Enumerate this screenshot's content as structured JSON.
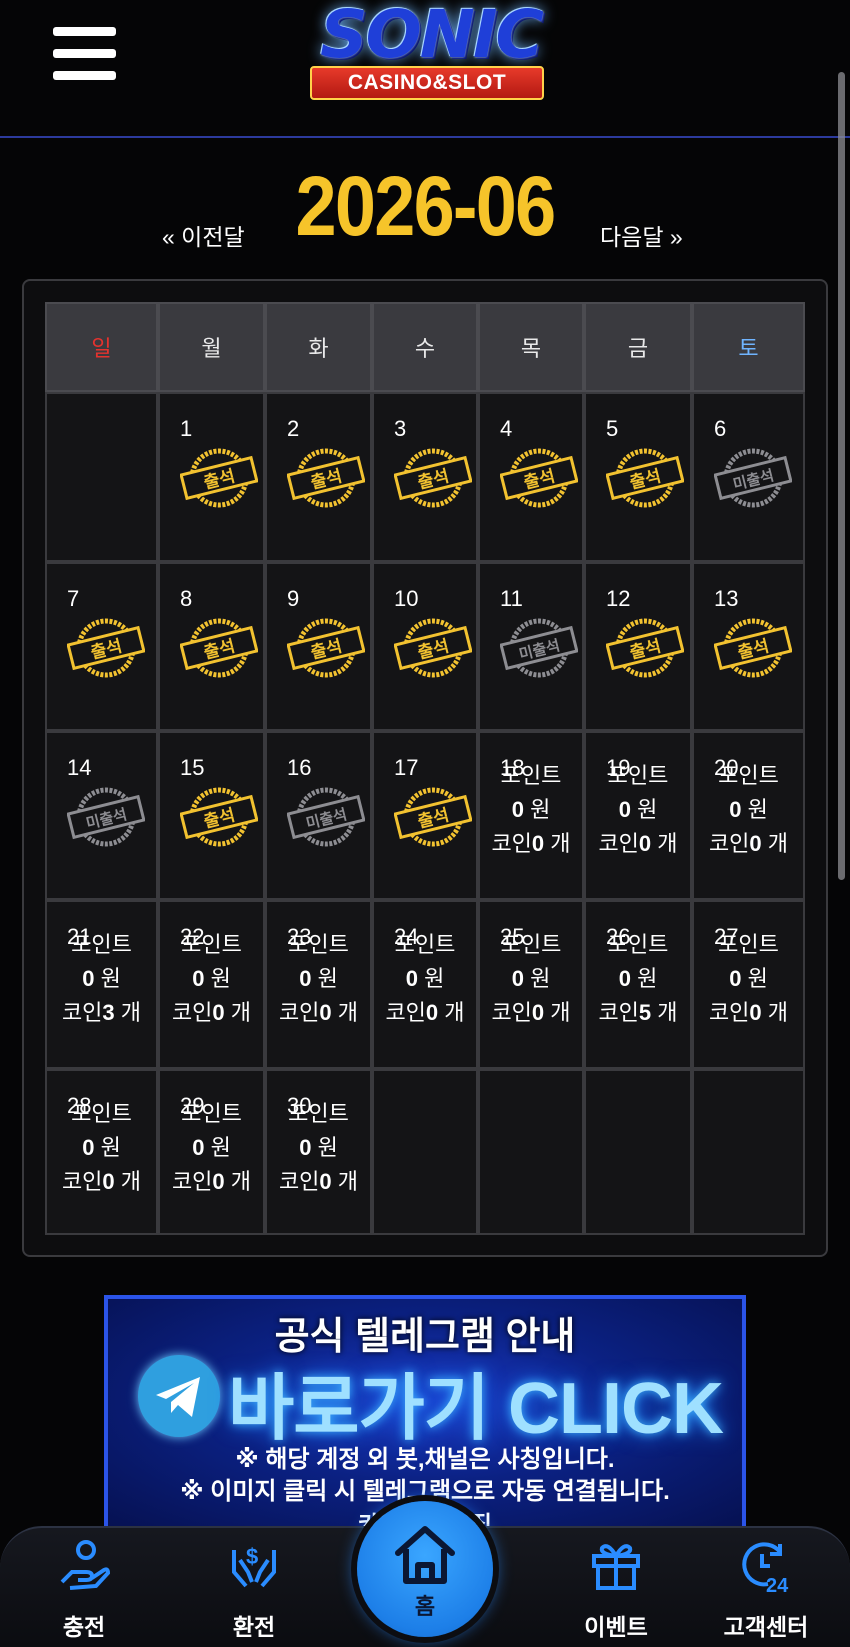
{
  "header": {
    "logo_main": "SONIC",
    "logo_sub": "CASINO&SLOT"
  },
  "month_nav": {
    "prev_label": "« 이전달",
    "title": "2026-06",
    "next_label": "다음달 »"
  },
  "calendar": {
    "weekdays": [
      "일",
      "월",
      "화",
      "수",
      "목",
      "금",
      "토"
    ],
    "stamp_attended": "출석",
    "stamp_absent": "미출석",
    "point_label": "포인트",
    "won_unit": "원",
    "coin_label": "코인",
    "coin_unit": "개",
    "days": [
      {
        "day": 1,
        "status": "attended"
      },
      {
        "day": 2,
        "status": "attended"
      },
      {
        "day": 3,
        "status": "attended"
      },
      {
        "day": 4,
        "status": "attended"
      },
      {
        "day": 5,
        "status": "attended"
      },
      {
        "day": 6,
        "status": "absent"
      },
      {
        "day": 7,
        "status": "attended"
      },
      {
        "day": 8,
        "status": "attended"
      },
      {
        "day": 9,
        "status": "attended"
      },
      {
        "day": 10,
        "status": "attended"
      },
      {
        "day": 11,
        "status": "absent"
      },
      {
        "day": 12,
        "status": "attended"
      },
      {
        "day": 13,
        "status": "attended"
      },
      {
        "day": 14,
        "status": "absent"
      },
      {
        "day": 15,
        "status": "attended"
      },
      {
        "day": 16,
        "status": "absent"
      },
      {
        "day": 17,
        "status": "attended"
      },
      {
        "day": 18,
        "status": "future",
        "points": 0,
        "coins": 0
      },
      {
        "day": 19,
        "status": "future",
        "points": 0,
        "coins": 0
      },
      {
        "day": 20,
        "status": "future",
        "points": 0,
        "coins": 0
      },
      {
        "day": 21,
        "status": "future",
        "points": 0,
        "coins": 3
      },
      {
        "day": 22,
        "status": "future",
        "points": 0,
        "coins": 0
      },
      {
        "day": 23,
        "status": "future",
        "points": 0,
        "coins": 0
      },
      {
        "day": 24,
        "status": "future",
        "points": 0,
        "coins": 0
      },
      {
        "day": 25,
        "status": "future",
        "points": 0,
        "coins": 0
      },
      {
        "day": 26,
        "status": "future",
        "points": 0,
        "coins": 5
      },
      {
        "day": 27,
        "status": "future",
        "points": 0,
        "coins": 0
      },
      {
        "day": 28,
        "status": "future",
        "points": 0,
        "coins": 0
      },
      {
        "day": 29,
        "status": "future",
        "points": 0,
        "coins": 0
      },
      {
        "day": 30,
        "status": "future",
        "points": 0,
        "coins": 0
      }
    ],
    "first_weekday_index": 1,
    "colors": {
      "attended_stamp": "#f2c230",
      "absent_stamp": "#8d8d92",
      "sunday": "#e5322e",
      "saturday": "#6fb4ff"
    }
  },
  "banner": {
    "title": "공식 텔레그램 안내",
    "cta": "바로가기 CLICK",
    "note1": "※ 해당 계정 외 봇,채널은 사칭입니다.",
    "note2": "※ 이미지 클릭 시 텔레그램으로 자동 연결됩니다.",
    "sub": "카지노 ·· 모집"
  },
  "bottom_nav": {
    "items": [
      {
        "id": "deposit",
        "label": "충전",
        "icon": "hand-coin-icon"
      },
      {
        "id": "withdraw",
        "label": "환전",
        "icon": "hands-money-icon"
      },
      {
        "id": "home",
        "label": "홈",
        "icon": "home-icon"
      },
      {
        "id": "event",
        "label": "이벤트",
        "icon": "gift-icon"
      },
      {
        "id": "support",
        "label": "고객센터",
        "icon": "support-24-icon"
      }
    ],
    "accent": "#1d7fe8"
  }
}
